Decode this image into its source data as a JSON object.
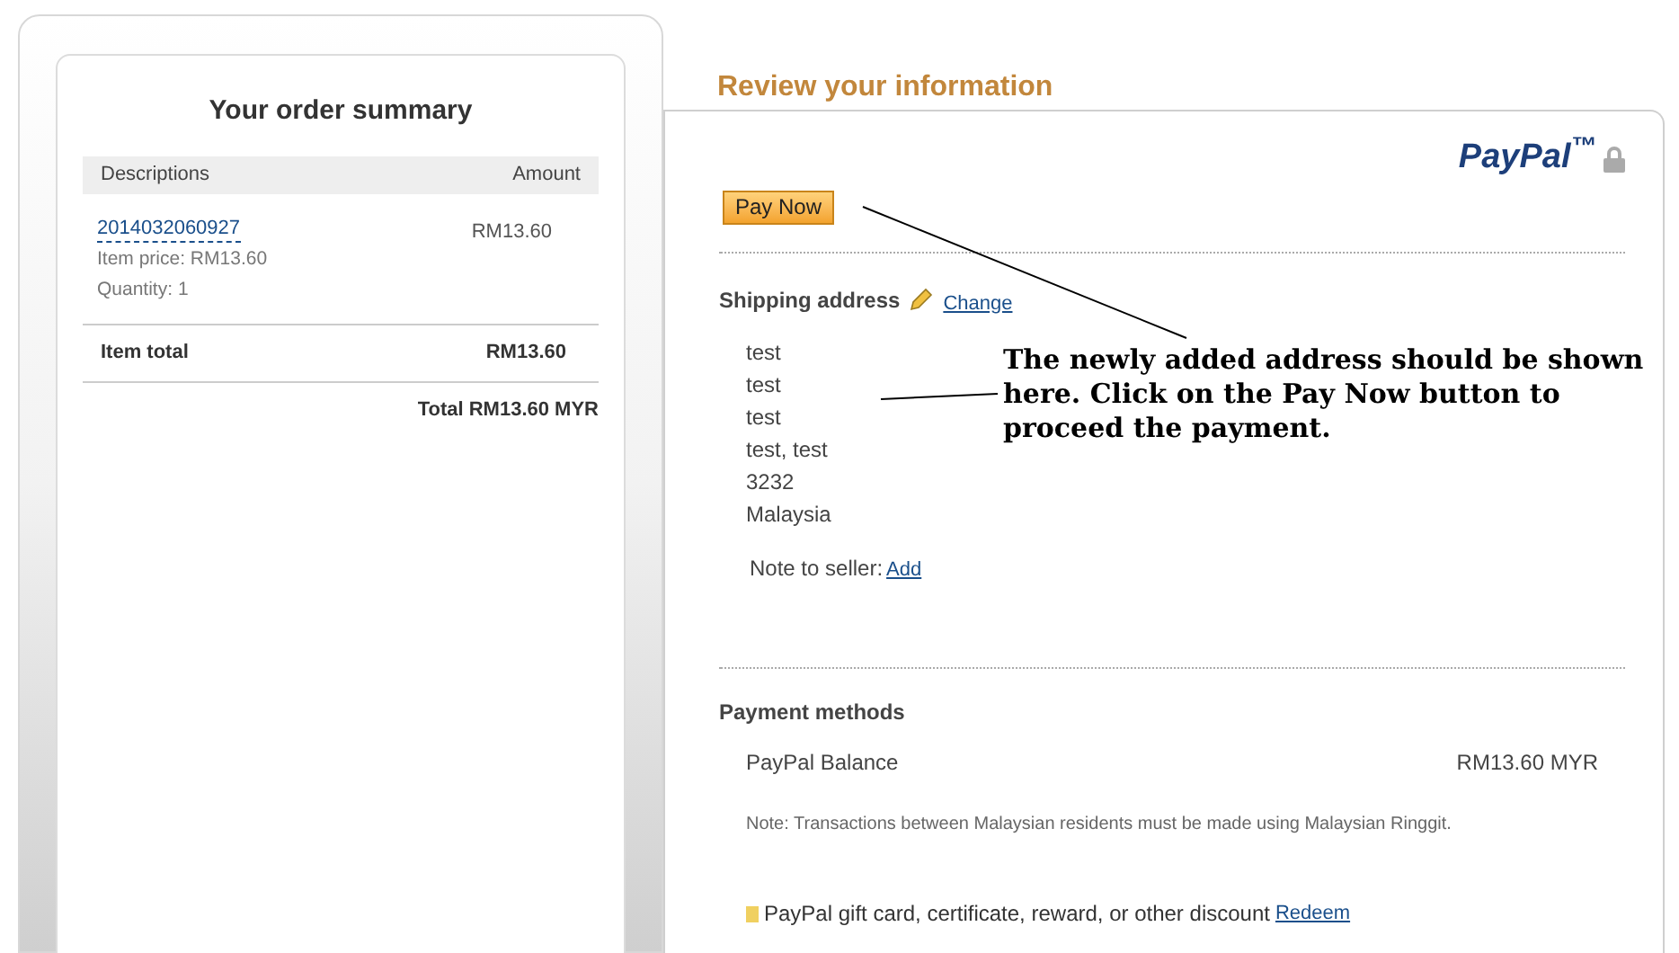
{
  "order_summary": {
    "title": "Your order summary",
    "columns": [
      "Descriptions",
      "Amount"
    ],
    "items": [
      {
        "id": "2014032060927",
        "price": "Item price: RM13.60",
        "quantity": "Quantity: 1",
        "amount": "RM13.60"
      }
    ],
    "item_total": {
      "label": "Item total",
      "amount": "RM13.60"
    },
    "total": "Total RM13.60 MYR"
  },
  "review": {
    "title": "Review your information",
    "logo": "PayPal$^{™}$",
    "pay_button": "Pay Now",
    "shipping": {
      "label": "Shipping address",
      "change_link": "Change",
      "lines": [
        "test",
        "test",
        "test",
        "test, test",
        "3232",
        "Malaysia"
      ],
      "note_label": "Note to seller:",
      "note_link": "Add"
    },
    "payment": {
      "label": "Payment methods",
      "method": "PayPal Balance",
      "amount": "RM13.60 MYR",
      "note": "Note: Transactions between Malaysian residents must be made using Malaysian Ringgit.",
      "gift": "PayPal gift card, certificate, reward, or other discount",
      "gift_link": "Redeem"
    }
  },
  "annotation": "The newly added address should be shown here. Click on the Pay Now button to proceed the payment."
}
